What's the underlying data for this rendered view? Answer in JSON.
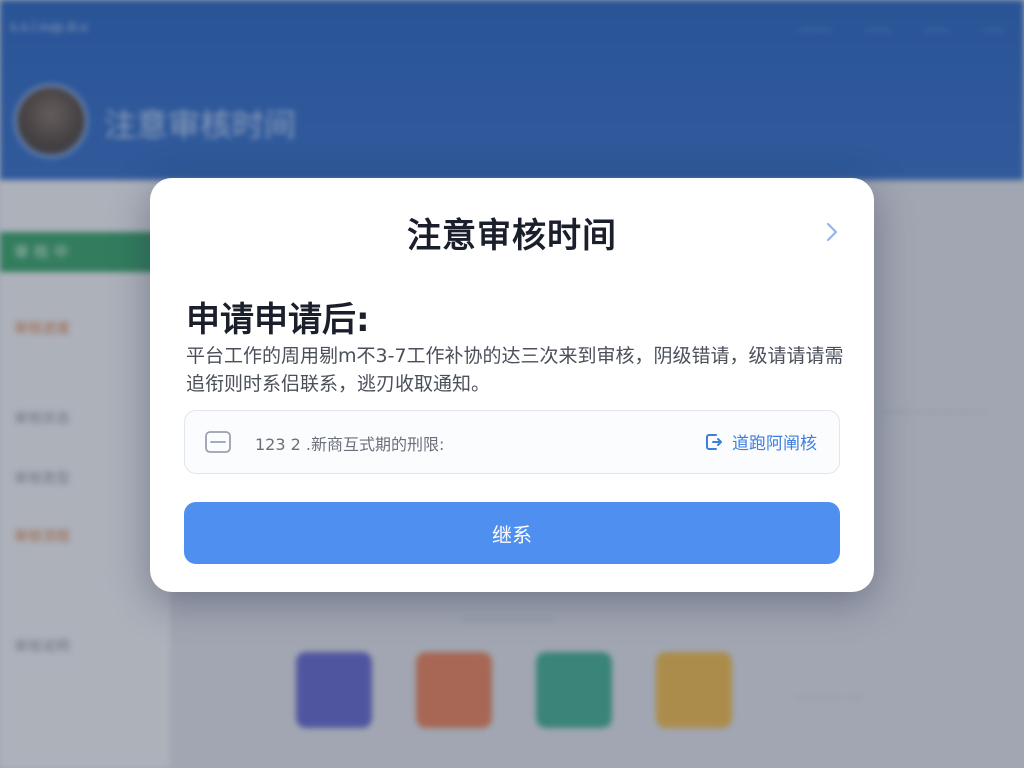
{
  "background": {
    "topbar": {
      "left_text": "s.s.l.sup.d.u",
      "right_items": [
        "........",
        "......",
        "......",
        "....."
      ],
      "profile_name": "注意审核时间"
    },
    "leftpanel": {
      "green_button_label": "审 核 中",
      "menu_items": [
        "审核进度",
        "审核状态",
        "审核类型",
        "审核流程",
        "审核说明"
      ]
    },
    "apps_label": "......................",
    "right_text_a": "..........................",
    "right_text_b": "...........  ...."
  },
  "modal": {
    "title": "注意审核时间",
    "heading": "申请申请后:",
    "description": "平台工作的周用剔m不3-7工作补协的达三次来到审核，阴级错请，级请请请需追衔则时系侣联系，逃刃收取通知。",
    "info_box": {
      "text": "123 2 .新商互式期的刑限:",
      "link_label": "道跑阿阐核"
    },
    "button_label": "继系"
  },
  "colors": {
    "brand_blue": "#2763bd",
    "primary_button": "#4e8ff0",
    "link_blue": "#3d7fe0",
    "green": "#2f9c61"
  },
  "icons": {
    "close": "chevron-right-icon",
    "info": "document-icon",
    "link": "exit-icon"
  }
}
